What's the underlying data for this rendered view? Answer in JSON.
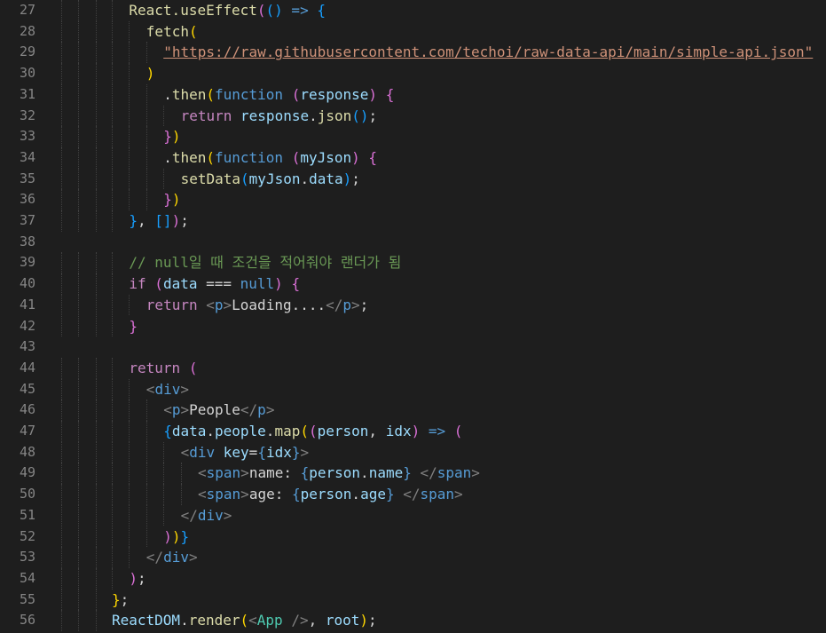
{
  "editor": {
    "language": "javascript-react",
    "colors": {
      "background": "#1e1e1e",
      "line_number": "#858585",
      "keyword": "#c586c0",
      "storage": "#569cd6",
      "function": "#dcdcaa",
      "variable": "#9cdcfe",
      "string": "#ce9178",
      "comment": "#6a9955",
      "class": "#4ec9b0",
      "bracket_1": "#ffd700",
      "bracket_2": "#da70d6",
      "bracket_3": "#179fff"
    },
    "lines": [
      {
        "num": "27",
        "indent": 1,
        "tokens": [
          [
            "f",
            "React.useEffect"
          ],
          [
            "p",
            "("
          ],
          [
            "bl",
            "()"
          ],
          [
            "b",
            " => "
          ],
          [
            "bl",
            "{"
          ]
        ]
      },
      {
        "num": "28",
        "indent": 2,
        "tokens": [
          [
            "f",
            "fetch"
          ],
          [
            "y",
            "("
          ]
        ]
      },
      {
        "num": "29",
        "indent": 3,
        "tokens": [
          [
            "su",
            "\"https://raw.githubusercontent.com/techoi/raw-data-api/main/simple-api.json\""
          ]
        ]
      },
      {
        "num": "30",
        "indent": 2,
        "tokens": [
          [
            "y",
            ")"
          ]
        ]
      },
      {
        "num": "31",
        "indent": 3,
        "tokens": [
          [
            "w",
            "."
          ],
          [
            "f",
            "then"
          ],
          [
            "y",
            "("
          ],
          [
            "b",
            "function "
          ],
          [
            "p",
            "("
          ],
          [
            "v",
            "response"
          ],
          [
            "p",
            ")"
          ],
          [
            "w",
            " "
          ],
          [
            "p",
            "{"
          ]
        ]
      },
      {
        "num": "32",
        "indent": 4,
        "tokens": [
          [
            "k",
            "return "
          ],
          [
            "v",
            "response"
          ],
          [
            "w",
            "."
          ],
          [
            "f",
            "json"
          ],
          [
            "bl",
            "()"
          ],
          [
            "w",
            ";"
          ]
        ]
      },
      {
        "num": "33",
        "indent": 3,
        "tokens": [
          [
            "p",
            "}"
          ],
          [
            "y",
            ")"
          ]
        ]
      },
      {
        "num": "34",
        "indent": 3,
        "tokens": [
          [
            "w",
            "."
          ],
          [
            "f",
            "then"
          ],
          [
            "y",
            "("
          ],
          [
            "b",
            "function "
          ],
          [
            "p",
            "("
          ],
          [
            "v",
            "myJson"
          ],
          [
            "p",
            ")"
          ],
          [
            "w",
            " "
          ],
          [
            "p",
            "{"
          ]
        ]
      },
      {
        "num": "35",
        "indent": 4,
        "tokens": [
          [
            "f",
            "setData"
          ],
          [
            "bl",
            "("
          ],
          [
            "v",
            "myJson"
          ],
          [
            "w",
            "."
          ],
          [
            "v",
            "data"
          ],
          [
            "bl",
            ")"
          ],
          [
            "w",
            ";"
          ]
        ]
      },
      {
        "num": "36",
        "indent": 3,
        "tokens": [
          [
            "p",
            "}"
          ],
          [
            "y",
            ")"
          ]
        ]
      },
      {
        "num": "37",
        "indent": 1,
        "tokens": [
          [
            "bl",
            "}"
          ],
          [
            "w",
            ", "
          ],
          [
            "bl",
            "[]"
          ],
          [
            "p",
            ")"
          ],
          [
            "w",
            ";"
          ]
        ]
      },
      {
        "num": "38",
        "indent": 0,
        "tokens": []
      },
      {
        "num": "39",
        "indent": 1,
        "tokens": [
          [
            "c",
            "// null일 때 조건을 적어줘야 랜더가 됨"
          ]
        ]
      },
      {
        "num": "40",
        "indent": 1,
        "tokens": [
          [
            "k",
            "if "
          ],
          [
            "p",
            "("
          ],
          [
            "v",
            "data"
          ],
          [
            "w",
            " === "
          ],
          [
            "b",
            "null"
          ],
          [
            "p",
            ")"
          ],
          [
            "w",
            " "
          ],
          [
            "p",
            "{"
          ]
        ]
      },
      {
        "num": "41",
        "indent": 2,
        "tokens": [
          [
            "k",
            "return "
          ],
          [
            "g",
            "<"
          ],
          [
            "t",
            "p"
          ],
          [
            "g",
            ">"
          ],
          [
            "tx",
            "Loading...."
          ],
          [
            "g",
            "</"
          ],
          [
            "t",
            "p"
          ],
          [
            "g",
            ">"
          ],
          [
            "w",
            ";"
          ]
        ]
      },
      {
        "num": "42",
        "indent": 1,
        "tokens": [
          [
            "p",
            "}"
          ]
        ]
      },
      {
        "num": "43",
        "indent": 0,
        "tokens": []
      },
      {
        "num": "44",
        "indent": 1,
        "tokens": [
          [
            "k",
            "return "
          ],
          [
            "p",
            "("
          ]
        ]
      },
      {
        "num": "45",
        "indent": 2,
        "tokens": [
          [
            "g",
            "<"
          ],
          [
            "t",
            "div"
          ],
          [
            "g",
            ">"
          ]
        ]
      },
      {
        "num": "46",
        "indent": 3,
        "tokens": [
          [
            "g",
            "<"
          ],
          [
            "t",
            "p"
          ],
          [
            "g",
            ">"
          ],
          [
            "tx",
            "People"
          ],
          [
            "g",
            "</"
          ],
          [
            "t",
            "p"
          ],
          [
            "g",
            ">"
          ]
        ]
      },
      {
        "num": "47",
        "indent": 3,
        "tokens": [
          [
            "bl",
            "{"
          ],
          [
            "v",
            "data"
          ],
          [
            "w",
            "."
          ],
          [
            "v",
            "people"
          ],
          [
            "w",
            "."
          ],
          [
            "f",
            "map"
          ],
          [
            "y",
            "("
          ],
          [
            "p",
            "("
          ],
          [
            "v",
            "person"
          ],
          [
            "w",
            ", "
          ],
          [
            "v",
            "idx"
          ],
          [
            "p",
            ")"
          ],
          [
            "b",
            " => "
          ],
          [
            "p",
            "("
          ]
        ]
      },
      {
        "num": "48",
        "indent": 4,
        "tokens": [
          [
            "g",
            "<"
          ],
          [
            "t",
            "div "
          ],
          [
            "a",
            "key"
          ],
          [
            "w",
            "="
          ],
          [
            "b",
            "{"
          ],
          [
            "v",
            "idx"
          ],
          [
            "b",
            "}"
          ],
          [
            "g",
            ">"
          ]
        ]
      },
      {
        "num": "49",
        "indent": 5,
        "tokens": [
          [
            "g",
            "<"
          ],
          [
            "t",
            "span"
          ],
          [
            "g",
            ">"
          ],
          [
            "tx",
            "name: "
          ],
          [
            "b",
            "{"
          ],
          [
            "v",
            "person"
          ],
          [
            "w",
            "."
          ],
          [
            "v",
            "name"
          ],
          [
            "b",
            "}"
          ],
          [
            "tx",
            " "
          ],
          [
            "g",
            "</"
          ],
          [
            "t",
            "span"
          ],
          [
            "g",
            ">"
          ]
        ]
      },
      {
        "num": "50",
        "indent": 5,
        "tokens": [
          [
            "g",
            "<"
          ],
          [
            "t",
            "span"
          ],
          [
            "g",
            ">"
          ],
          [
            "tx",
            "age: "
          ],
          [
            "b",
            "{"
          ],
          [
            "v",
            "person"
          ],
          [
            "w",
            "."
          ],
          [
            "v",
            "age"
          ],
          [
            "b",
            "}"
          ],
          [
            "tx",
            " "
          ],
          [
            "g",
            "</"
          ],
          [
            "t",
            "span"
          ],
          [
            "g",
            ">"
          ]
        ]
      },
      {
        "num": "51",
        "indent": 4,
        "tokens": [
          [
            "g",
            "</"
          ],
          [
            "t",
            "div"
          ],
          [
            "g",
            ">"
          ]
        ]
      },
      {
        "num": "52",
        "indent": 3,
        "tokens": [
          [
            "p",
            ")"
          ],
          [
            "y",
            ")"
          ],
          [
            "bl",
            "}"
          ]
        ]
      },
      {
        "num": "53",
        "indent": 2,
        "tokens": [
          [
            "g",
            "</"
          ],
          [
            "t",
            "div"
          ],
          [
            "g",
            ">"
          ]
        ]
      },
      {
        "num": "54",
        "indent": 1,
        "tokens": [
          [
            "p",
            ")"
          ],
          [
            "w",
            ";"
          ]
        ]
      },
      {
        "num": "55",
        "indent": 0,
        "tokens": [
          [
            "y",
            "}"
          ],
          [
            "w",
            ";"
          ]
        ]
      },
      {
        "num": "56",
        "indent": 0,
        "tokens": [
          [
            "v",
            "ReactDOM"
          ],
          [
            "w",
            "."
          ],
          [
            "f",
            "render"
          ],
          [
            "y",
            "("
          ],
          [
            "g",
            "<"
          ],
          [
            "cl",
            "App"
          ],
          [
            "g",
            " />"
          ],
          [
            "w",
            ", "
          ],
          [
            "v",
            "root"
          ],
          [
            "y",
            ")"
          ],
          [
            "w",
            ";"
          ]
        ]
      }
    ]
  }
}
